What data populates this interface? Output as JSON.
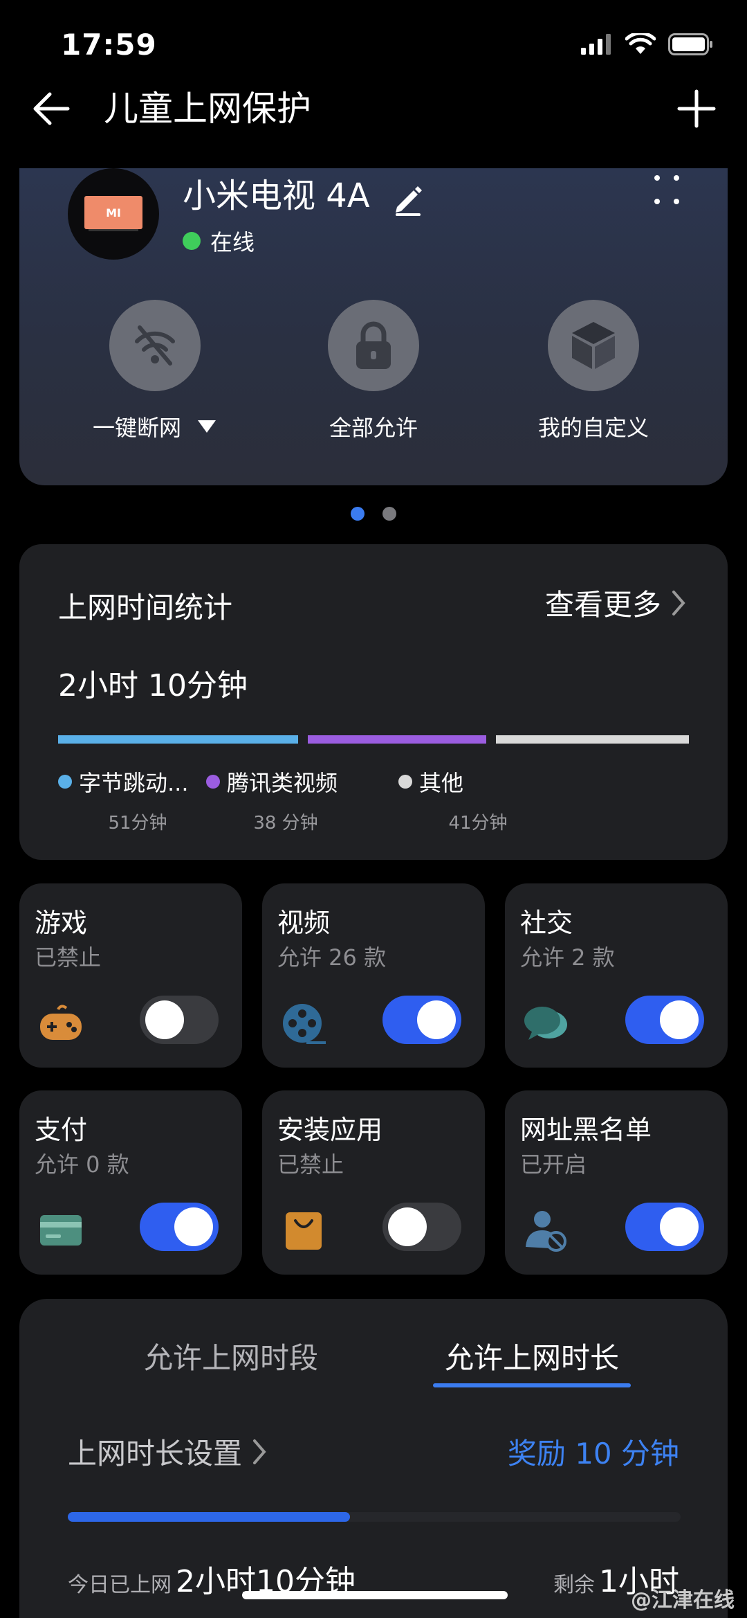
{
  "status_bar": {
    "time": "17:59"
  },
  "nav": {
    "title": "儿童上网保护"
  },
  "device": {
    "name": "小米电视 4A",
    "logo_text": "MI",
    "status": "在线",
    "modes": [
      {
        "label": "一键断网",
        "icon": "wifi-off-icon"
      },
      {
        "label": "全部允许",
        "icon": "lock-icon"
      },
      {
        "label": "我的自定义",
        "icon": "cube-icon"
      }
    ]
  },
  "stats": {
    "title": "上网时间统计",
    "more": "查看更多",
    "total": "2小时 10分钟",
    "segments": [
      {
        "name": "字节跳动...",
        "minutes": 51,
        "duration": "51分钟",
        "color": "#5ab0e8"
      },
      {
        "name": "腾讯类视频",
        "minutes": 38,
        "duration": "38 分钟",
        "color": "#9b5de0"
      },
      {
        "name": "其他",
        "minutes": 41,
        "duration": "41分钟",
        "color": "#d9d9d9"
      }
    ]
  },
  "tiles": [
    {
      "name": "游戏",
      "sub": "已禁止",
      "icon": "gamepad-icon",
      "enabled": false
    },
    {
      "name": "视频",
      "sub": "允许 26 款",
      "icon": "film-reel-icon",
      "enabled": true
    },
    {
      "name": "社交",
      "sub": "允许 2 款",
      "icon": "chat-bubbles-icon",
      "enabled": true
    },
    {
      "name": "支付",
      "sub": "允许 0 款",
      "icon": "card-icon",
      "enabled": true
    },
    {
      "name": "安装应用",
      "sub": "已禁止",
      "icon": "shopping-bag-icon",
      "enabled": false
    },
    {
      "name": "网址黑名单",
      "sub": "已开启",
      "icon": "user-block-icon",
      "enabled": true
    }
  ],
  "time_limit": {
    "tabs": [
      "允许上网时段",
      "允许上网时长"
    ],
    "active_tab": 1,
    "setting_label": "上网时长设置",
    "reward": "奖励 10 分钟",
    "progress": 0.46,
    "today_label": "今日已上网",
    "today_value": "2小时10分钟",
    "remaining_label": "剩余",
    "remaining_value": "1小时"
  },
  "watermark": "@江津在线",
  "colors": {
    "accent": "#3b7cf0",
    "toggle_on": "#2f5ef0",
    "online": "#3fcd5b"
  }
}
